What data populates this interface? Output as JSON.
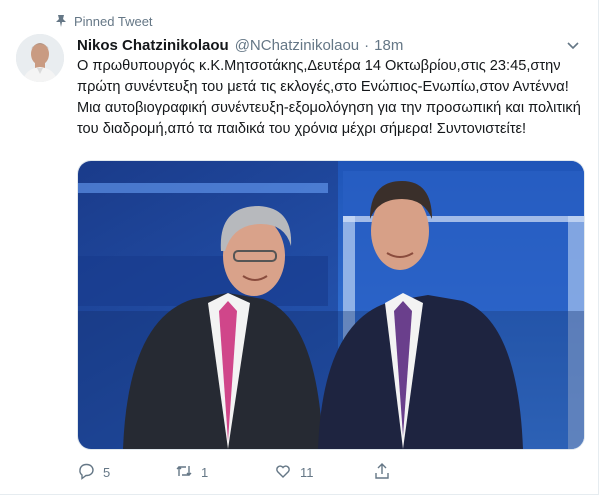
{
  "pinned_label": "Pinned Tweet",
  "author": {
    "name": "Nikos Chatzinikolaou",
    "handle": "@NChatzinikolaou",
    "separator": "·",
    "time": "18m"
  },
  "tweet_text": "Ο πρωθυπουργός κ.Κ.Μητσοτάκης,Δευτέρα 14 Οκτωβρίου,στις 23:45,στην πρώτη συνέντευξη του μετά τις εκλογές,στο Ενώπιος-Ενωπίω,στον Αντέννα! Μια αυτοβιογραφική συνέντευξη-εξομολόγηση για την προσωπική και πολιτική του διαδρομή,από τα παιδικά του χρόνια μέχρι σήμερα! Συντονιστείτε!",
  "actions": {
    "reply_count": "5",
    "retweet_count": "1",
    "like_count": "11"
  },
  "icons": {
    "pin": "pin-icon",
    "caret": "chevron-down-icon",
    "reply": "reply-icon",
    "retweet": "retweet-icon",
    "like": "heart-icon",
    "share": "share-icon"
  },
  "colors": {
    "text": "#14171a",
    "secondary": "#657786",
    "border": "#e6ecf0"
  }
}
